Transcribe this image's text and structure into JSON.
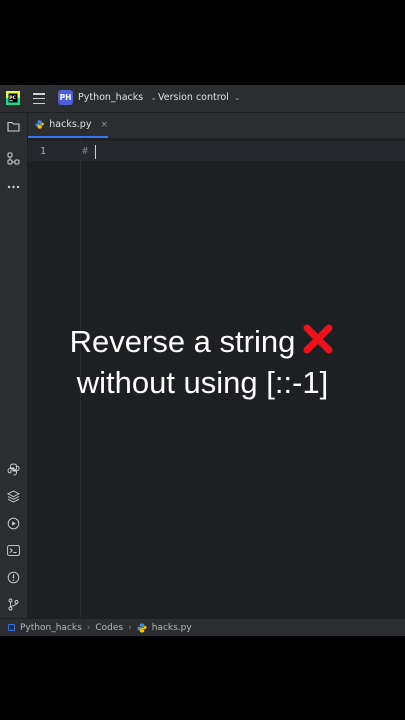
{
  "titlebar": {
    "project_badge": "PH",
    "project_name": "Python_hacks",
    "vcs_label": "Version control"
  },
  "tab": {
    "label": "hacks.py",
    "close": "×"
  },
  "editor": {
    "line_number": "1",
    "code": "#"
  },
  "statusbar": {
    "crumbs": [
      "Python_hacks",
      "Codes",
      "hacks.py"
    ],
    "separator": "›"
  },
  "overlay": {
    "line1": "Reverse a string",
    "line2": "without using [::-1]"
  },
  "colors": {
    "background": "#2b2d30",
    "editor_bg": "#1e1f22",
    "accent": "#3574f0",
    "badge": "#4e5fd6",
    "cross": "#e8131b"
  }
}
